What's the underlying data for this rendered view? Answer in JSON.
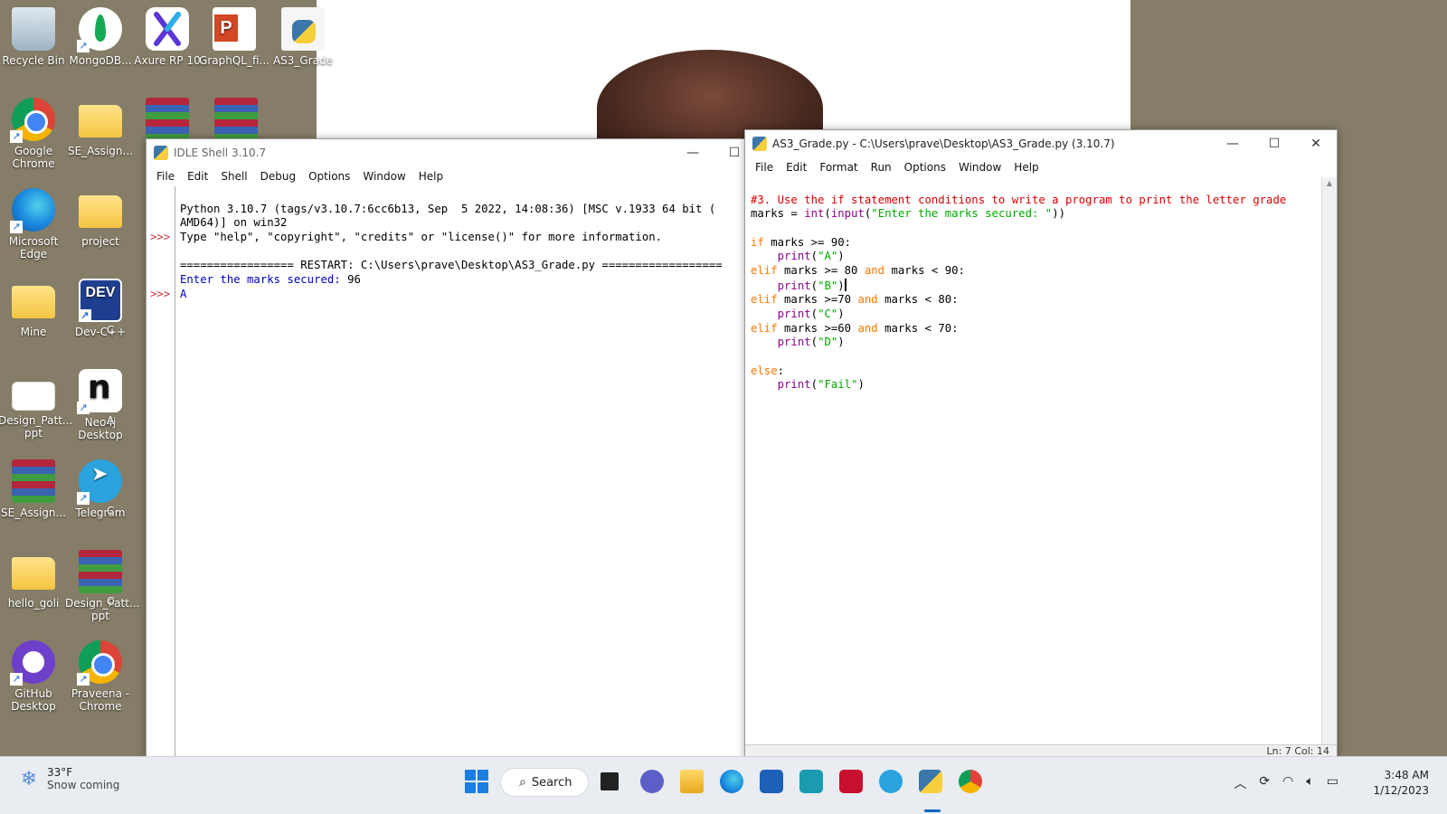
{
  "desktop": {
    "icons": [
      {
        "label": "Recycle Bin"
      },
      {
        "label": "MongoDB..."
      },
      {
        "label": "Axure RP 10"
      },
      {
        "label": "GraphQL_fi..."
      },
      {
        "label": "AS3_Grade"
      },
      {
        "label": "Google Chrome"
      },
      {
        "label": "SE_Assign..."
      },
      {
        "label": "Microsoft Edge"
      },
      {
        "label": "project"
      },
      {
        "label": "Mine"
      },
      {
        "label": "Dev-C++"
      },
      {
        "label": "Design_Patt... ppt"
      },
      {
        "label": "Neo4j Desktop"
      },
      {
        "label": "SE_Assign..."
      },
      {
        "label": "Telegram"
      },
      {
        "label": "hello_goli"
      },
      {
        "label": "Design_Patt... ppt"
      },
      {
        "label": "GitHub Desktop"
      },
      {
        "label": "Praveena - Chrome"
      }
    ],
    "dev_icon_text": "DEV",
    "cut_off_letters": [
      "C",
      "A",
      "C",
      "C"
    ]
  },
  "shell": {
    "title": "IDLE Shell 3.10.7",
    "menu": [
      "File",
      "Edit",
      "Shell",
      "Debug",
      "Options",
      "Window",
      "Help"
    ],
    "prompt": ">>>",
    "lines": [
      "Python 3.10.7 (tags/v3.10.7:6cc6b13, Sep  5 2022, 14:08:36) [MSC v.1933 64 bit (",
      "AMD64)] on win32",
      "Type \"help\", \"copyright\", \"credits\" or \"license()\" for more information.",
      "",
      "================= RESTART: C:\\Users\\prave\\Desktop\\AS3_Grade.py ==================",
      "Enter the marks secured: ",
      "A"
    ],
    "user_input": "96"
  },
  "editor": {
    "title": "AS3_Grade.py - C:\\Users\\prave\\Desktop\\AS3_Grade.py (3.10.7)",
    "menu": [
      "File",
      "Edit",
      "Format",
      "Run",
      "Options",
      "Window",
      "Help"
    ],
    "code": {
      "comment": "#3. Use the if statement conditions to write a program to print the letter grade",
      "l2": {
        "a": "marks = ",
        "int": "int",
        "b": "(",
        "input": "input",
        "c": "(",
        "str": "\"Enter the marks secured: \"",
        "d": "))"
      },
      "if_kw": "if",
      "if_rest": " marks >= 90:",
      "print_kw": "print",
      "pA": "\"A\"",
      "elif_kw": "elif",
      "e1a": " marks >= 80 ",
      "and_kw": "and",
      "e1b": " marks < 90:",
      "pB": "\"B\"",
      "e2a": " marks >=70 ",
      "e2b": " marks < 80:",
      "pC": "\"C\"",
      "e3a": " marks >=60 ",
      "e3b": " marks < 70:",
      "pD": "\"D\"",
      "else_kw": "else",
      "colon": ":",
      "pF": "\"Fail\""
    },
    "status": "Ln: 7   Col: 14"
  },
  "taskbar": {
    "temperature": "33°F",
    "weather_text": "Snow coming",
    "search_label": "Search",
    "time": "3:48 AM",
    "date": "1/12/2023"
  }
}
